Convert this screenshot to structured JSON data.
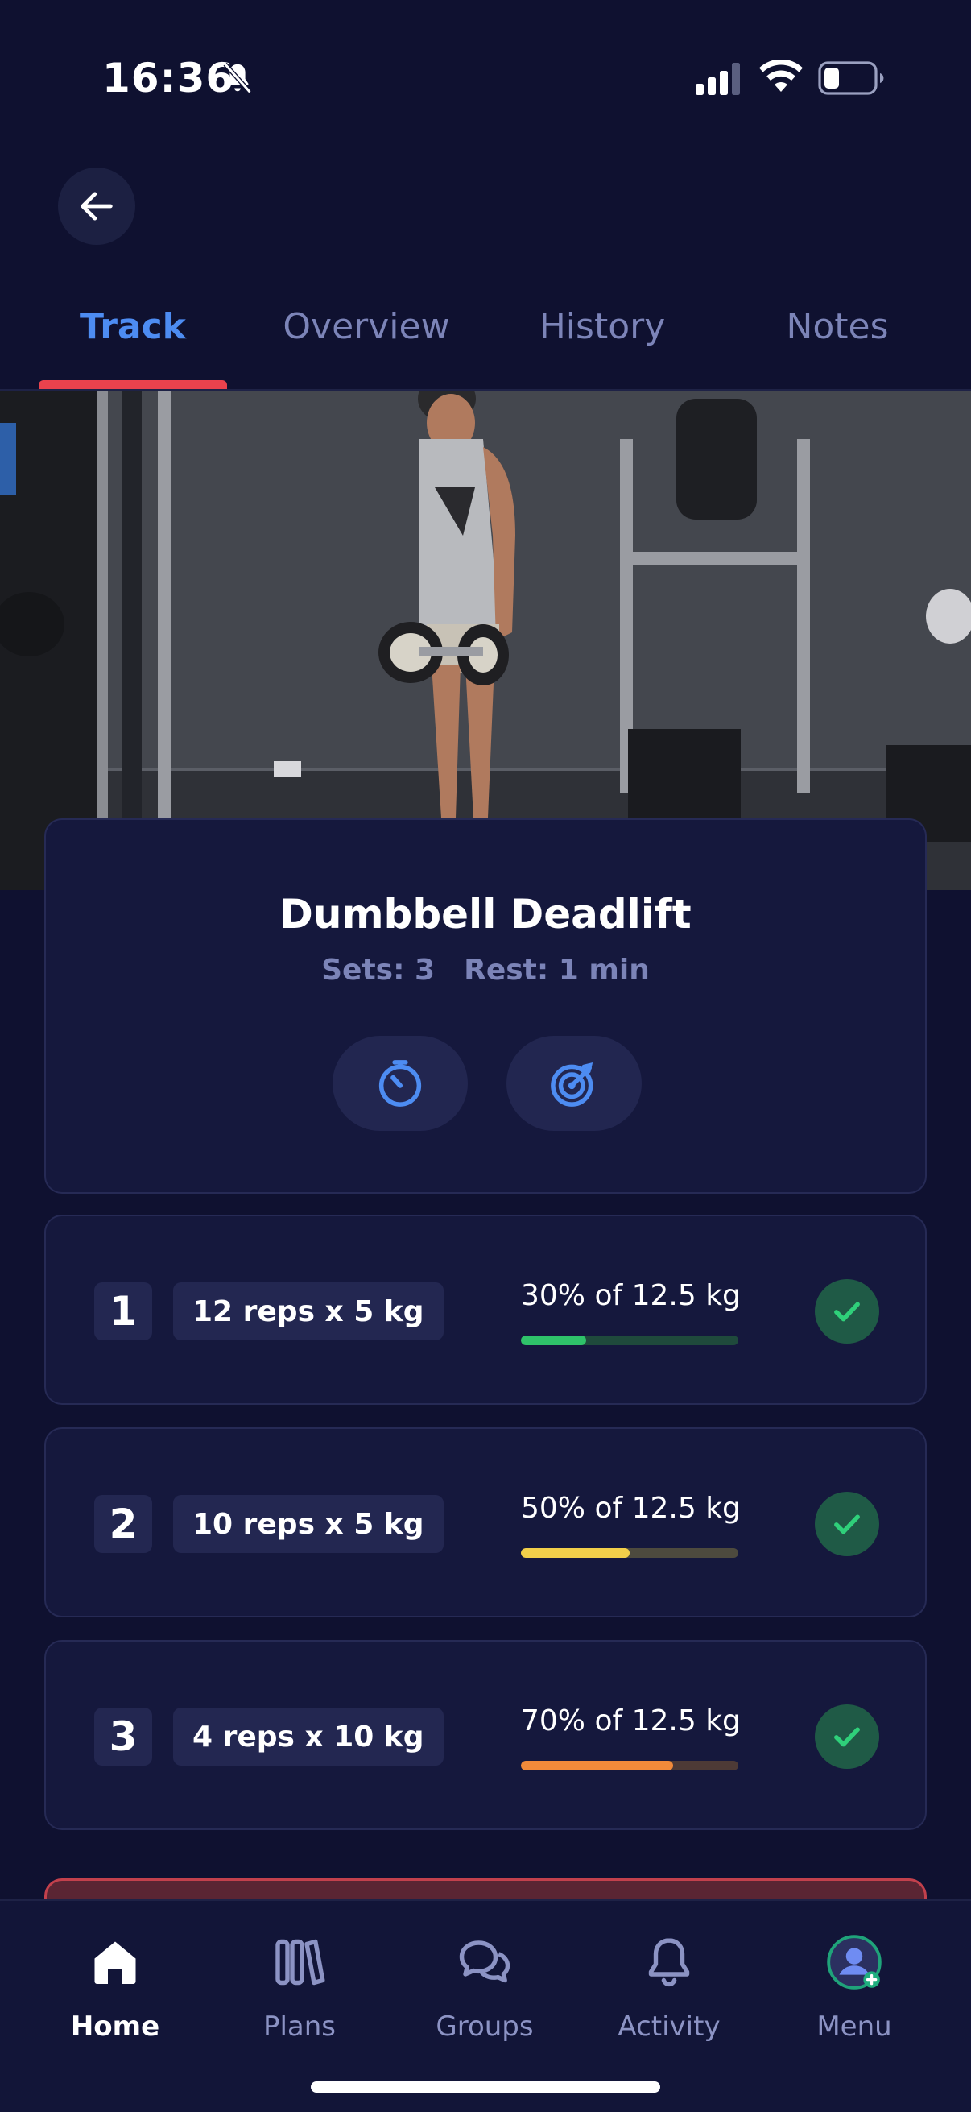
{
  "status": {
    "time": "16:36"
  },
  "tabs": [
    {
      "label": "Track"
    },
    {
      "label": "Overview"
    },
    {
      "label": "History"
    },
    {
      "label": "Notes"
    }
  ],
  "exercise": {
    "title": "Dumbbell Deadlift",
    "sets_text": "Sets: 3",
    "rest_text": "Rest: 1 min"
  },
  "sets": [
    {
      "number": "1",
      "label": "12 reps x 5 kg",
      "percent_text": "30% of 12.5 kg",
      "progress": 0.3,
      "bar_color": "#2fc26a",
      "track_color": "#1f4a3c",
      "completed": true
    },
    {
      "number": "2",
      "label": "10 reps x 5 kg",
      "percent_text": "50% of 12.5 kg",
      "progress": 0.5,
      "bar_color": "#f2cf4a",
      "track_color": "#4d4a3e",
      "completed": true
    },
    {
      "number": "3",
      "label": "4 reps x 10 kg",
      "percent_text": "70% of 12.5 kg",
      "progress": 0.7,
      "bar_color": "#f28a3a",
      "track_color": "#4d3a36",
      "completed": true
    }
  ],
  "nav": [
    {
      "label": "Home",
      "icon": "home-icon"
    },
    {
      "label": "Plans",
      "icon": "plans-icon"
    },
    {
      "label": "Groups",
      "icon": "groups-icon"
    },
    {
      "label": "Activity",
      "icon": "bell-icon"
    },
    {
      "label": "Menu",
      "icon": "avatar-icon"
    }
  ],
  "colors": {
    "background": "#0f1130",
    "accent": "#4d8cf2",
    "tab_indicator": "#e9424d",
    "card": "#15183d"
  }
}
